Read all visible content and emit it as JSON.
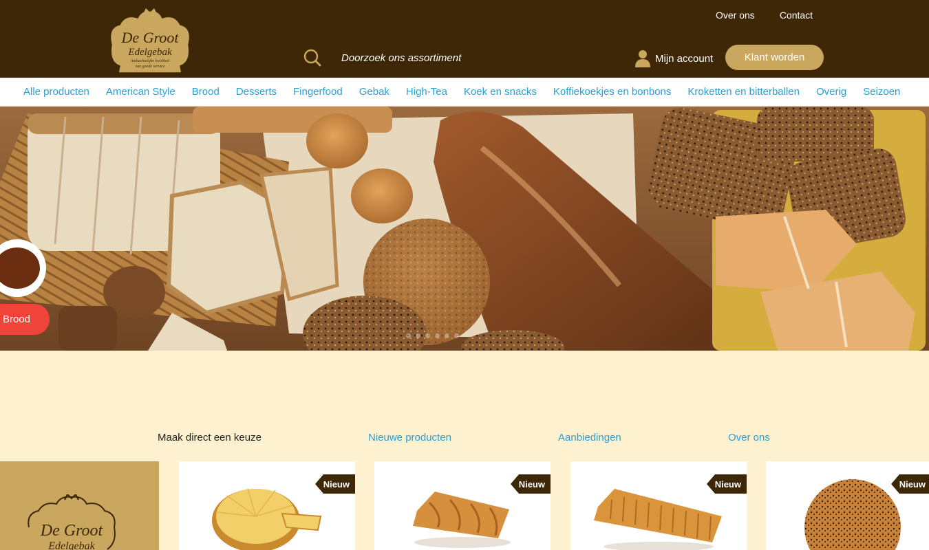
{
  "brand": {
    "name_line1": "De Groot",
    "name_line2": "Edelgebak",
    "tagline1": "Ambachtelijke kwaliteit",
    "tagline2": "van goede service"
  },
  "colors": {
    "header_bg": "#3e2707",
    "gold": "#c9a75e",
    "link_blue": "#2a9fd6",
    "page_bg": "#fdf1cf",
    "tag_red": "#f0433a"
  },
  "top_links": [
    "Over ons",
    "Contact"
  ],
  "search": {
    "placeholder": "Doorzoek ons assortiment",
    "icon": "search-icon"
  },
  "account": {
    "label": "Mijn account",
    "icon": "user-icon"
  },
  "cta": {
    "label": "Klant worden"
  },
  "categories": [
    "Alle producten",
    "American Style",
    "Brood",
    "Desserts",
    "Fingerfood",
    "Gebak",
    "High-Tea",
    "Koek en snacks",
    "Koffiekoekjes en bonbons",
    "Kroketten en bitterballen",
    "Overig",
    "Seizoen"
  ],
  "hero": {
    "tag": "Brood"
  },
  "choice": {
    "label": "Maak direct een keuze",
    "links": [
      "Nieuwe producten",
      "Aanbiedingen",
      "Over ons"
    ]
  },
  "products": [
    {
      "badge": "Nieuw"
    },
    {
      "badge": "Nieuw"
    },
    {
      "badge": "Nieuw"
    },
    {
      "badge": "Nieuw"
    }
  ]
}
